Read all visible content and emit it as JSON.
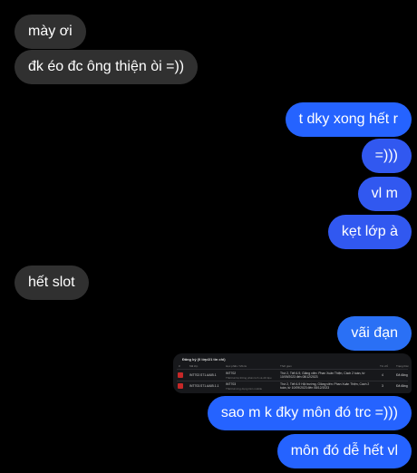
{
  "messages": {
    "m1": "mày ơi",
    "m2": "đk éo đc ông thiện òi =))",
    "m3": "t dky xong hết r",
    "m4": "=)))",
    "m5": "vl m",
    "m6": "kẹt lớp à",
    "m7": "hết slot",
    "m8": "vãi đạn",
    "m9": "sao m k đky môn đó trc =)))",
    "m10": "môn đó dễ hết vl"
  },
  "shared_image": {
    "title": "Đăng ký (0 lớp/21 tín chỉ)",
    "headers": [
      "#",
      "Mã lớp",
      "Học phần / Mô tả",
      "Thời gian",
      "Tín chỉ",
      "Trạng thái"
    ],
    "rows": [
      {
        "class_code": "INT702.S71.AAIB.1",
        "course": "INT702",
        "course_sub": "Thiết kế hệ thống phân tích và dữ liệu",
        "schedule": "Thứ 2, Tiết 6-9, Giảng viên: Phan Xuân Thiện, Cách 2 tuần, từ 10/09/2023 đến 08/12/2023",
        "credits": "4",
        "status": "Đã đăng"
      },
      {
        "class_code": "INT703.S71.AAIB.1.1",
        "course": "INT703",
        "course_sub": "Thiết kế ứng dụng trên mobile",
        "schedule": "Thứ 2, Tiết 6-9 Hội trường, Giảng viên: Phan Xuân Thiện, Cách 2 tuần, từ 10/09/2023 đến 08/12/2023",
        "credits": "3",
        "status": "Đã đăng"
      }
    ]
  },
  "colors": {
    "background": "#000000",
    "incoming_bubble": "#303030",
    "outgoing_bubble": "#2563ff",
    "text": "#ffffff",
    "delete_mark": "#c62828"
  }
}
